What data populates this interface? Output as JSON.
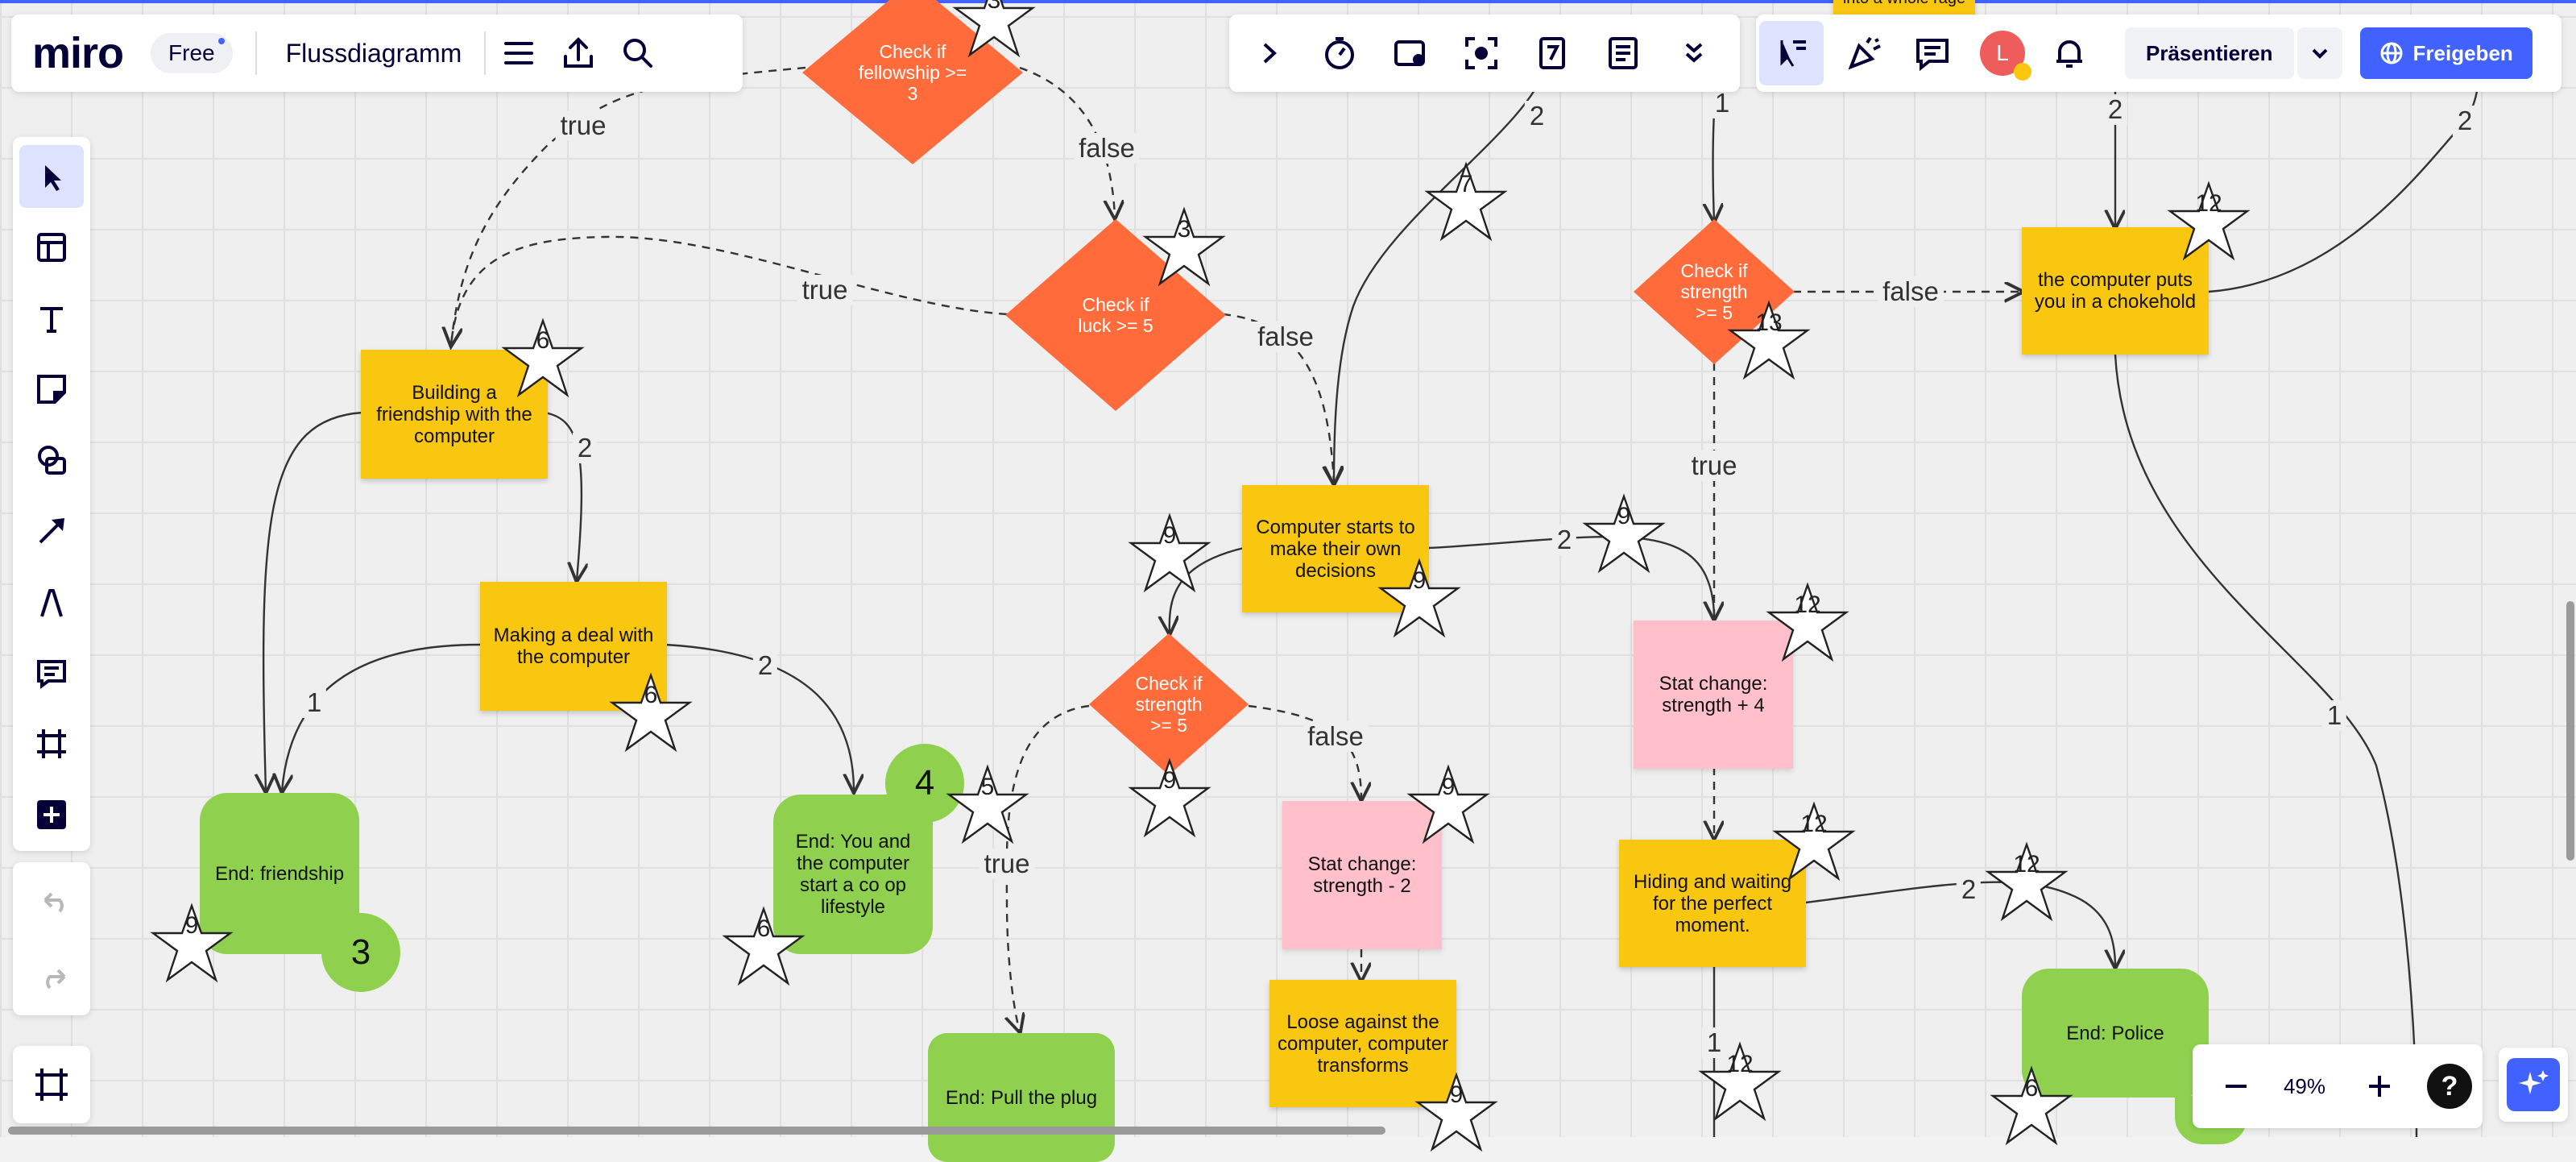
{
  "app": {
    "logo": "miro",
    "plan": "Free",
    "board_name": "Flussdiagramm"
  },
  "topbar": {
    "present_label": "Präsentieren",
    "share_label": "Freigeben",
    "avatar_initial": "L"
  },
  "zoom": {
    "level": "49%",
    "help": "?"
  },
  "colors": {
    "sticky": "#fac710",
    "decision": "#ff6b3b",
    "stat": "#ffc0cb",
    "end": "#8fd14f",
    "accent": "#4262ff"
  },
  "icons": {
    "left_toolbar": [
      "cursor-icon",
      "templates-icon",
      "text-icon",
      "sticky-note-icon",
      "shapes-icon",
      "pen-arrow-icon",
      "draw-icon",
      "comment-icon",
      "frame-icon",
      "add-more-icon"
    ],
    "top_toolbar": [
      "chevron-right-icon",
      "timer-icon",
      "card-icon",
      "focus-icon",
      "voting-icon",
      "notes-icon",
      "chevron-down-double-icon"
    ],
    "collab": [
      "cursor-follow-icon",
      "reactions-icon",
      "comments-icon",
      "bell-icon"
    ]
  },
  "nodes": {
    "rage": "into a whole rage",
    "fellowship": "Check if fellowship >= 3",
    "luck": "Check if luck >= 5",
    "friendship_building": "Building a friendship with the computer",
    "deal": "Making a deal with the computer",
    "end_friendship": "End: friendship",
    "end_coop": "End: You and the computer start a co op lifestyle",
    "computer_decisions": "Computer starts to make their own decisions",
    "check_strength_mid": "Check if strength >= 5",
    "stat_minus": "Stat change: strength - 2",
    "loose": "Loose against the computer, computer transforms",
    "end_plug": "End: Pull the plug",
    "check_strength_right": "Check if strength >= 5",
    "stat_plus": "Stat change: strength + 4",
    "hiding": "Hiding and waiting for the perfect moment.",
    "chokehold": "the computer puts you in a chokehold",
    "end_police": "End: Police"
  },
  "edge_labels": {
    "fellowship_true": "true",
    "fellowship_false": "false",
    "luck_true": "true",
    "luck_false": "false",
    "friendship_to_deal": "2",
    "deal_to_friendship": "1",
    "deal_to_coop": "2",
    "strength_mid_true": "true",
    "strength_mid_false": "false",
    "decisions_to_right": "2",
    "strength_right_false": "false",
    "strength_right_true": "true",
    "hiding_to_police": "2",
    "hiding_down": "1",
    "top_to_decisions": "2",
    "top_to_strength": "1",
    "top_to_chokehold": "2",
    "top_right": "2",
    "chokehold_down": "1"
  },
  "badges": {
    "coop": "4",
    "friendship": "3"
  },
  "stars": [
    "3",
    "3",
    "7",
    "6",
    "6",
    "9",
    "9",
    "9",
    "9",
    "9",
    "9",
    "5",
    "13",
    "12",
    "12",
    "12",
    "12",
    "12",
    "6",
    "6",
    "9"
  ]
}
